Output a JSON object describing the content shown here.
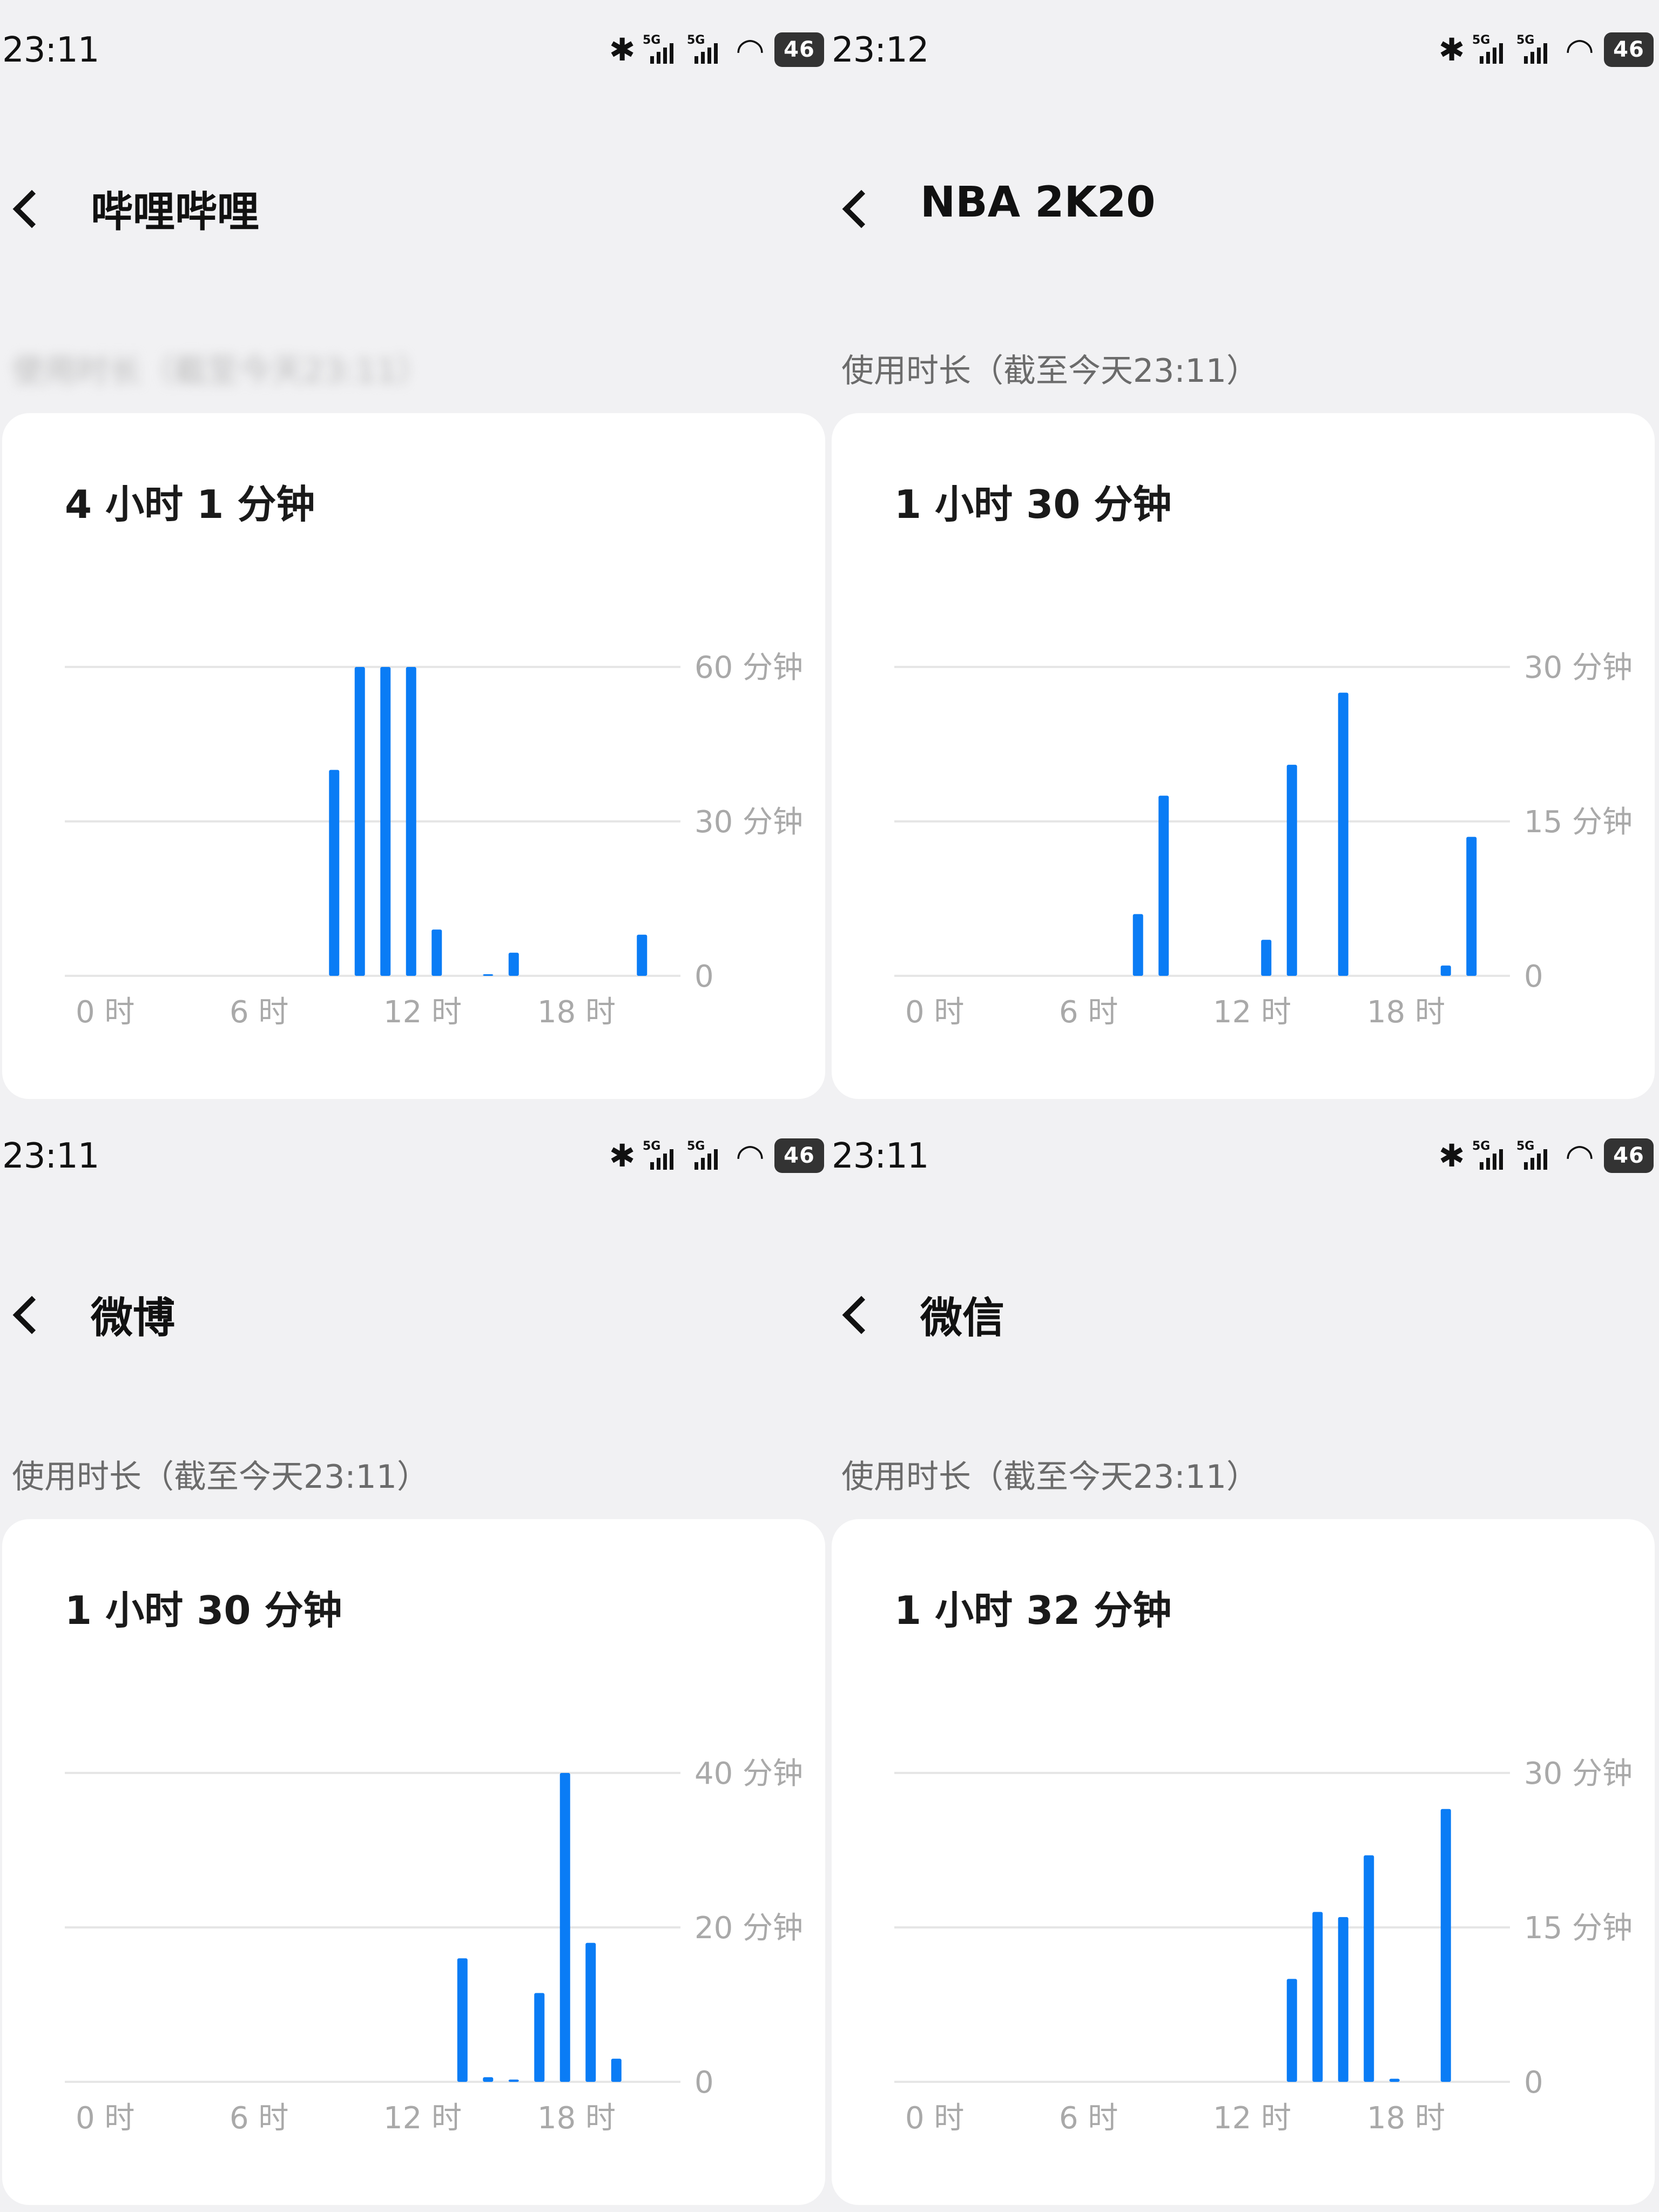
{
  "panels": [
    {
      "status": {
        "time": "23:11",
        "battery": "46"
      },
      "header": {
        "title": "哔哩哔哩"
      },
      "usage_label": "使用时长（截至今天23:11）",
      "total": "4 小时 1 分钟",
      "chart_data": {
        "type": "bar",
        "x": [
          0,
          1,
          2,
          3,
          4,
          5,
          6,
          7,
          8,
          9,
          10,
          11,
          12,
          13,
          14,
          15,
          16,
          17,
          18,
          19,
          20,
          21,
          22,
          23
        ],
        "values": [
          0,
          0,
          0,
          0,
          0,
          0,
          0,
          0,
          0,
          0,
          40,
          60,
          60,
          60,
          9,
          0,
          0.3,
          4.5,
          0,
          0,
          0,
          0,
          8,
          0
        ],
        "ylim": [
          0,
          60
        ],
        "yticks": [
          {
            "v": 60,
            "label": "60 分钟"
          },
          {
            "v": 30,
            "label": "30 分钟"
          },
          {
            "v": 0,
            "label": "0"
          }
        ],
        "xticks": [
          {
            "h": 0,
            "label": "0 时"
          },
          {
            "h": 6,
            "label": "6 时"
          },
          {
            "h": 12,
            "label": "12 时"
          },
          {
            "h": 18,
            "label": "18 时"
          }
        ],
        "color": "#0a7cf5"
      }
    },
    {
      "status": {
        "time": "23:12",
        "battery": "46"
      },
      "header": {
        "title": "NBA 2K20"
      },
      "usage_label": "使用时长（截至今天23:11）",
      "total": "1 小时 30 分钟",
      "chart_data": {
        "type": "bar",
        "x": [
          0,
          1,
          2,
          3,
          4,
          5,
          6,
          7,
          8,
          9,
          10,
          11,
          12,
          13,
          14,
          15,
          16,
          17,
          18,
          19,
          20,
          21,
          22,
          23
        ],
        "values": [
          0,
          0,
          0,
          0,
          0,
          0,
          0,
          0,
          0,
          6,
          17.5,
          0,
          0,
          0,
          3.5,
          20.5,
          0,
          27.5,
          0,
          0,
          0,
          1,
          13.5,
          0
        ],
        "ylim": [
          0,
          30
        ],
        "yticks": [
          {
            "v": 30,
            "label": "30 分钟"
          },
          {
            "v": 15,
            "label": "15 分钟"
          },
          {
            "v": 0,
            "label": "0"
          }
        ],
        "xticks": [
          {
            "h": 0,
            "label": "0 时"
          },
          {
            "h": 6,
            "label": "6 时"
          },
          {
            "h": 12,
            "label": "12 时"
          },
          {
            "h": 18,
            "label": "18 时"
          }
        ],
        "color": "#0a7cf5"
      }
    },
    {
      "status": {
        "time": "23:11",
        "battery": "46"
      },
      "header": {
        "title": "微博"
      },
      "usage_label": "使用时长（截至今天23:11）",
      "total": "1 小时 30 分钟",
      "chart_data": {
        "type": "bar",
        "x": [
          0,
          1,
          2,
          3,
          4,
          5,
          6,
          7,
          8,
          9,
          10,
          11,
          12,
          13,
          14,
          15,
          16,
          17,
          18,
          19,
          20,
          21,
          22,
          23
        ],
        "values": [
          0,
          0,
          0,
          0,
          0,
          0,
          0,
          0,
          0,
          0,
          0,
          0,
          0,
          0,
          0,
          16,
          0.6,
          0.3,
          11.5,
          40,
          18,
          3,
          0,
          0
        ],
        "ylim": [
          0,
          40
        ],
        "yticks": [
          {
            "v": 40,
            "label": "40 分钟"
          },
          {
            "v": 20,
            "label": "20 分钟"
          },
          {
            "v": 0,
            "label": "0"
          }
        ],
        "xticks": [
          {
            "h": 0,
            "label": "0 时"
          },
          {
            "h": 6,
            "label": "6 时"
          },
          {
            "h": 12,
            "label": "12 时"
          },
          {
            "h": 18,
            "label": "18 时"
          }
        ],
        "color": "#0a7cf5"
      }
    },
    {
      "status": {
        "time": "23:11",
        "battery": "46"
      },
      "header": {
        "title": "微信"
      },
      "usage_label": "使用时长（截至今天23:11）",
      "total": "1 小时 32 分钟",
      "chart_data": {
        "type": "bar",
        "x": [
          0,
          1,
          2,
          3,
          4,
          5,
          6,
          7,
          8,
          9,
          10,
          11,
          12,
          13,
          14,
          15,
          16,
          17,
          18,
          19,
          20,
          21,
          22,
          23
        ],
        "values": [
          0,
          0,
          0,
          0,
          0,
          0,
          0,
          0,
          0,
          0,
          0,
          0,
          0,
          0,
          0,
          10,
          16.5,
          16,
          22,
          0.3,
          0,
          26.5,
          0,
          0
        ],
        "ylim": [
          0,
          30
        ],
        "yticks": [
          {
            "v": 30,
            "label": "30 分钟"
          },
          {
            "v": 15,
            "label": "15 分钟"
          },
          {
            "v": 0,
            "label": "0"
          }
        ],
        "xticks": [
          {
            "h": 0,
            "label": "0 时"
          },
          {
            "h": 6,
            "label": "6 时"
          },
          {
            "h": 12,
            "label": "12 时"
          },
          {
            "h": 18,
            "label": "18 时"
          }
        ],
        "color": "#0a7cf5"
      }
    }
  ]
}
